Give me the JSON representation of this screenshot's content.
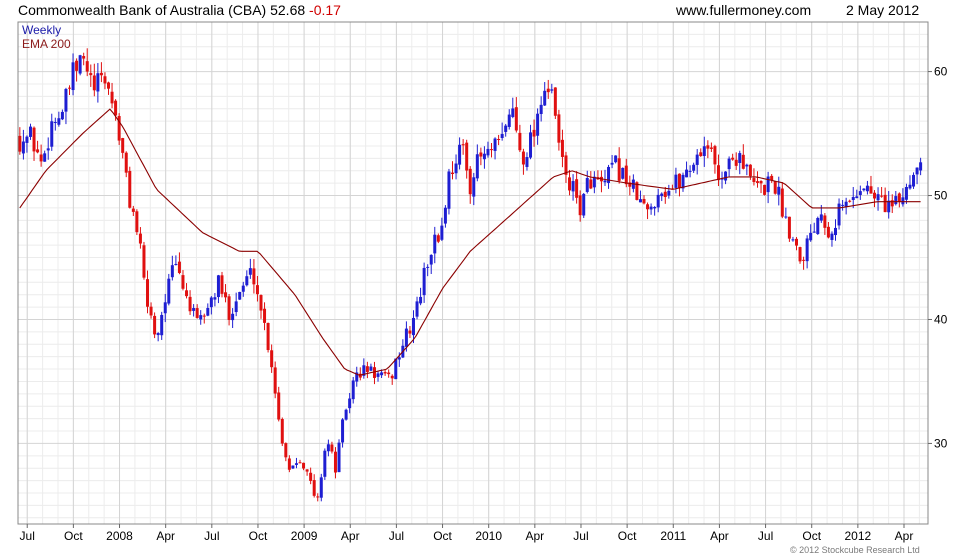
{
  "header": {
    "title": "Commonwealth Bank of Australia (CBA)",
    "price": "52.68",
    "change": "-0.17",
    "site": "www.fullermoney.com",
    "date": "2 May 2012"
  },
  "copyright": "© 2012 Stockcube Research Ltd",
  "colors": {
    "up": "#1e1ed2",
    "down": "#e01010",
    "ema": "#8b0000",
    "grid": "#d4d4d4",
    "weekly_label": "#1a1aa8",
    "ema_label": "#8b1a1a"
  },
  "chart_data": {
    "type": "candlestick",
    "legend": [
      "Weekly",
      "EMA 200"
    ],
    "legend_position": "top-left",
    "y_axis_side": "right",
    "ylim": [
      23.5,
      64
    ],
    "ytick_values": [
      30,
      40,
      50,
      60
    ],
    "xlim": [
      2007.45,
      2012.38
    ],
    "xticks": [
      {
        "label": "Jul",
        "t": 2007.5
      },
      {
        "label": "Oct",
        "t": 2007.75
      },
      {
        "label": "2008",
        "t": 2008.0
      },
      {
        "label": "Apr",
        "t": 2008.25
      },
      {
        "label": "Jul",
        "t": 2008.5
      },
      {
        "label": "Oct",
        "t": 2008.75
      },
      {
        "label": "2009",
        "t": 2009.0
      },
      {
        "label": "Apr",
        "t": 2009.25
      },
      {
        "label": "Jul",
        "t": 2009.5
      },
      {
        "label": "Oct",
        "t": 2009.75
      },
      {
        "label": "2010",
        "t": 2010.0
      },
      {
        "label": "Apr",
        "t": 2010.25
      },
      {
        "label": "Jul",
        "t": 2010.5
      },
      {
        "label": "Oct",
        "t": 2010.75
      },
      {
        "label": "2011",
        "t": 2011.0
      },
      {
        "label": "Apr",
        "t": 2011.25
      },
      {
        "label": "Jul",
        "t": 2011.5
      },
      {
        "label": "Oct",
        "t": 2011.75
      },
      {
        "label": "2012",
        "t": 2012.0
      },
      {
        "label": "Apr",
        "t": 2012.25
      }
    ],
    "close_anchors": [
      [
        2007.46,
        54.5
      ],
      [
        2007.52,
        54.8
      ],
      [
        2007.58,
        52.5
      ],
      [
        2007.63,
        55.8
      ],
      [
        2007.7,
        57.0
      ],
      [
        2007.74,
        59.5
      ],
      [
        2007.8,
        61.0
      ],
      [
        2007.86,
        58.5
      ],
      [
        2007.92,
        59.5
      ],
      [
        2007.98,
        56.5
      ],
      [
        2008.05,
        50.0
      ],
      [
        2008.1,
        47.0
      ],
      [
        2008.14,
        42.0
      ],
      [
        2008.2,
        38.5
      ],
      [
        2008.25,
        42.0
      ],
      [
        2008.3,
        44.5
      ],
      [
        2008.36,
        42.0
      ],
      [
        2008.42,
        39.5
      ],
      [
        2008.48,
        41.0
      ],
      [
        2008.54,
        43.0
      ],
      [
        2008.59,
        40.5
      ],
      [
        2008.66,
        42.5
      ],
      [
        2008.72,
        44.0
      ],
      [
        2008.78,
        40.0
      ],
      [
        2008.83,
        36.0
      ],
      [
        2008.87,
        31.0
      ],
      [
        2008.92,
        28.0
      ],
      [
        2008.98,
        29.0
      ],
      [
        2009.03,
        27.0
      ],
      [
        2009.07,
        25.0
      ],
      [
        2009.12,
        30.5
      ],
      [
        2009.17,
        28.0
      ],
      [
        2009.22,
        32.5
      ],
      [
        2009.28,
        35.5
      ],
      [
        2009.34,
        36.0
      ],
      [
        2009.4,
        35.5
      ],
      [
        2009.46,
        35.0
      ],
      [
        2009.52,
        37.5
      ],
      [
        2009.58,
        39.5
      ],
      [
        2009.62,
        41.5
      ],
      [
        2009.68,
        45.5
      ],
      [
        2009.74,
        47.0
      ],
      [
        2009.79,
        52.0
      ],
      [
        2009.85,
        54.0
      ],
      [
        2009.9,
        51.0
      ],
      [
        2009.95,
        53.0
      ],
      [
        2010.02,
        53.5
      ],
      [
        2010.08,
        54.5
      ],
      [
        2010.12,
        57.5
      ],
      [
        2010.18,
        53.0
      ],
      [
        2010.24,
        55.0
      ],
      [
        2010.3,
        59.0
      ],
      [
        2010.35,
        57.5
      ],
      [
        2010.39,
        53.0
      ],
      [
        2010.45,
        50.5
      ],
      [
        2010.5,
        49.0
      ],
      [
        2010.55,
        51.5
      ],
      [
        2010.62,
        50.5
      ],
      [
        2010.68,
        52.5
      ],
      [
        2010.74,
        51.5
      ],
      [
        2010.8,
        50.0
      ],
      [
        2010.86,
        48.5
      ],
      [
        2010.92,
        50.5
      ],
      [
        2010.98,
        50.5
      ],
      [
        2011.05,
        51.5
      ],
      [
        2011.12,
        53.0
      ],
      [
        2011.18,
        54.5
      ],
      [
        2011.24,
        51.5
      ],
      [
        2011.3,
        52.5
      ],
      [
        2011.36,
        53.5
      ],
      [
        2011.42,
        51.0
      ],
      [
        2011.48,
        50.5
      ],
      [
        2011.54,
        51.5
      ],
      [
        2011.6,
        48.5
      ],
      [
        2011.65,
        46.5
      ],
      [
        2011.7,
        45.0
      ],
      [
        2011.74,
        47.0
      ],
      [
        2011.8,
        49.0
      ],
      [
        2011.85,
        47.0
      ],
      [
        2011.9,
        49.0
      ],
      [
        2011.96,
        49.5
      ],
      [
        2012.02,
        51.0
      ],
      [
        2012.08,
        50.0
      ],
      [
        2012.14,
        49.5
      ],
      [
        2012.2,
        49.0
      ],
      [
        2012.26,
        50.5
      ],
      [
        2012.3,
        52.0
      ],
      [
        2012.34,
        52.68
      ]
    ],
    "ema_200": [
      [
        2007.46,
        49.0
      ],
      [
        2007.6,
        52.0
      ],
      [
        2007.8,
        55.0
      ],
      [
        2007.95,
        57.0
      ],
      [
        2008.02,
        55.5
      ],
      [
        2008.2,
        50.5
      ],
      [
        2008.45,
        47.0
      ],
      [
        2008.65,
        45.5
      ],
      [
        2008.75,
        45.5
      ],
      [
        2008.95,
        42.0
      ],
      [
        2009.1,
        38.5
      ],
      [
        2009.22,
        36.0
      ],
      [
        2009.3,
        35.5
      ],
      [
        2009.45,
        36.0
      ],
      [
        2009.6,
        38.5
      ],
      [
        2009.75,
        42.5
      ],
      [
        2009.9,
        45.5
      ],
      [
        2010.05,
        47.5
      ],
      [
        2010.2,
        49.5
      ],
      [
        2010.35,
        51.5
      ],
      [
        2010.45,
        52.0
      ],
      [
        2010.55,
        51.5
      ],
      [
        2010.75,
        51.0
      ],
      [
        2011.0,
        50.5
      ],
      [
        2011.3,
        51.5
      ],
      [
        2011.45,
        51.5
      ],
      [
        2011.6,
        51.0
      ],
      [
        2011.75,
        49.0
      ],
      [
        2011.9,
        49.0
      ],
      [
        2012.1,
        49.5
      ],
      [
        2012.34,
        49.5
      ]
    ]
  }
}
